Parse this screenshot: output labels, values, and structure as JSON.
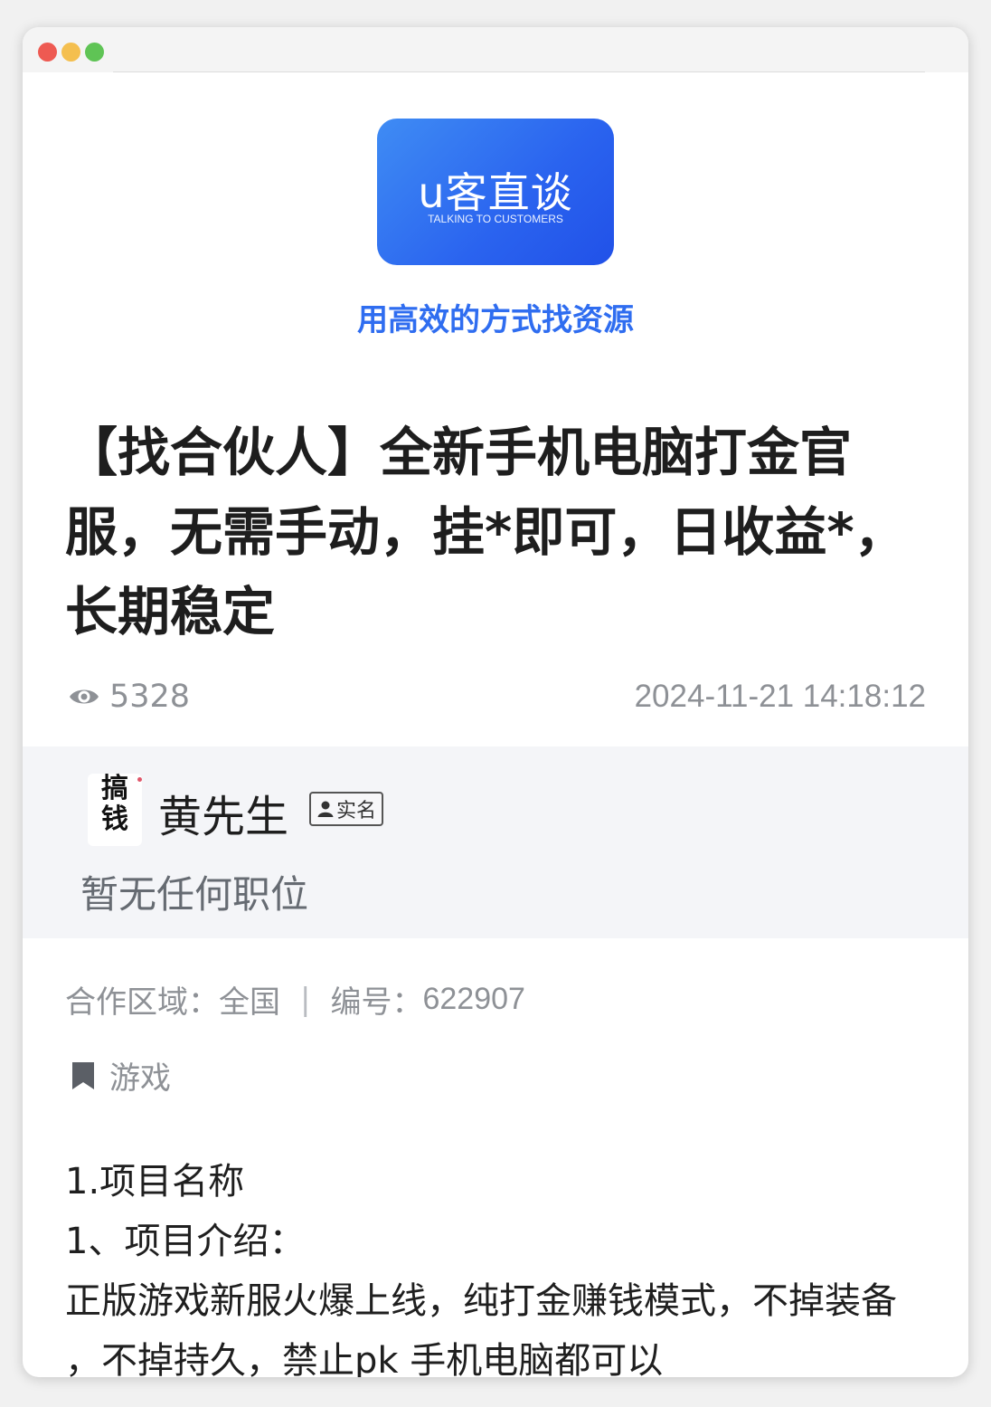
{
  "logo": {
    "main_text": "u客直谈",
    "sub_text": "TALKING TO CUSTOMERS"
  },
  "tagline": "用高效的方式找资源",
  "post": {
    "title": "【找合伙人】全新手机电脑打金官服，无需手动，挂*即可，日收益*，长期稳定",
    "views": "5328",
    "date": "2024-11-21 14:18:12"
  },
  "author": {
    "avatar_line1": "搞",
    "avatar_line2": "钱",
    "name": "黄先生",
    "badge": "实名",
    "position": "暂无任何职位"
  },
  "info": {
    "region_label": "合作区域：",
    "region_value": "全国",
    "separator": "|",
    "id_label": "编号：",
    "id_value": "622907"
  },
  "category": "游戏",
  "body": {
    "line1": "1.项目名称",
    "line2": "1、项目介绍：",
    "line3": "正版游戏新服火爆上线，纯打金赚钱模式，不掉装备 ，不掉持久，禁止pk 手机电脑都可以"
  },
  "colors": {
    "brand_blue": "#2f6df0",
    "logo_gradient_start": "#3f8cf4",
    "logo_gradient_end": "#2151e8",
    "muted_text": "#8e9196",
    "author_bg": "#f4f5f8"
  },
  "icons": {
    "views": "eye-icon",
    "badge": "person-icon",
    "category": "bookmark-icon"
  }
}
